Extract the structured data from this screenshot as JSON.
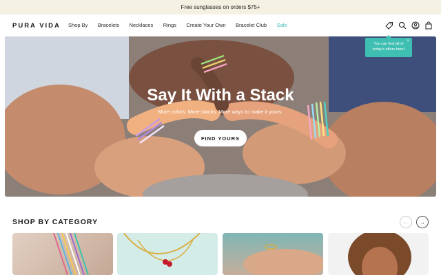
{
  "announcement": "Free sunglasses on orders $75+",
  "logo": "PURA VIDA",
  "nav": {
    "items": [
      "Shop By",
      "Bracelets",
      "Necklaces",
      "Rings",
      "Create Your Own",
      "Bracelet Club",
      "Sale"
    ],
    "icons": [
      "tag-icon",
      "search-icon",
      "account-icon",
      "bag-icon"
    ]
  },
  "tooltip": {
    "text_line1": "You can find all of",
    "text_line2": "today's offers here!",
    "close": "×"
  },
  "hero": {
    "title": "Say It With a Stack",
    "subtitle": "More colors. More stacks. More ways to make it yours.",
    "cta": "FIND YOURS"
  },
  "category": {
    "title": "SHOP BY CATEGORY",
    "prev": "←",
    "next": "→"
  },
  "colors": {
    "accent": "#3fbfb1",
    "announcement_bg": "#f4f1e2"
  }
}
